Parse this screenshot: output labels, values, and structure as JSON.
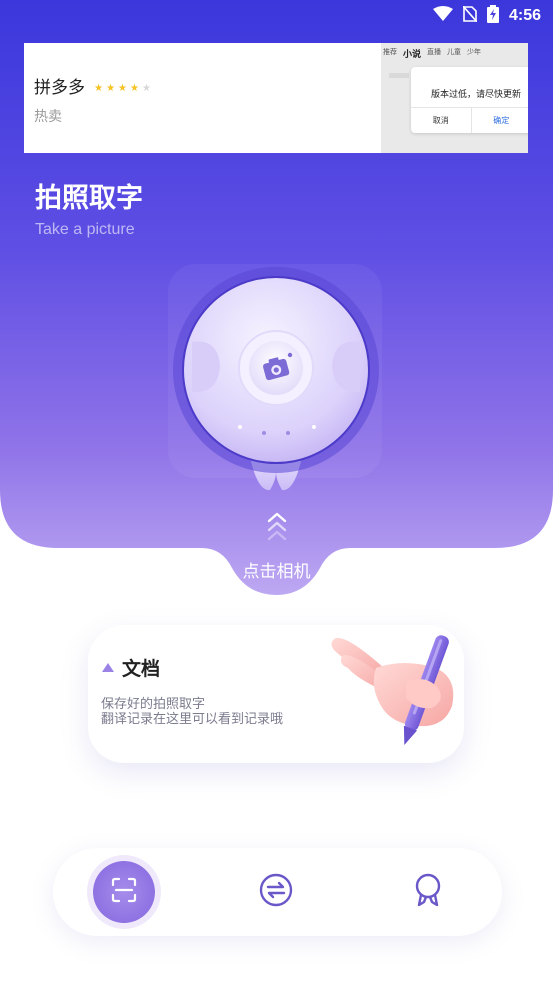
{
  "status_bar": {
    "time": "4:56"
  },
  "ad": {
    "brand": "拼多多",
    "rating": 4,
    "rating_max": 5,
    "tag": "热卖",
    "preview_nav": [
      "推荐",
      "小说",
      "直播",
      "儿童",
      "少年"
    ],
    "dialog_message": "版本过低，请尽快更新",
    "dialog_cancel": "取消",
    "dialog_confirm": "确定"
  },
  "hero": {
    "title": "拍照取字",
    "subtitle": "Take a picture",
    "click_label": "点击相机"
  },
  "doc_card": {
    "title": "文档",
    "desc_line1": "保存好的拍照取字",
    "desc_line2": "翻译记录在这里可以看到记录哦"
  },
  "bottom_nav": {
    "items": [
      {
        "icon": "scan-icon",
        "active": true
      },
      {
        "icon": "translate-icon",
        "active": false
      },
      {
        "icon": "award-icon",
        "active": false
      }
    ]
  },
  "colors": {
    "gradient_top": "#3b37dc",
    "gradient_mid": "#6a5ae6",
    "gradient_bottom": "#b7a0f0",
    "accent": "#8e72e2"
  }
}
